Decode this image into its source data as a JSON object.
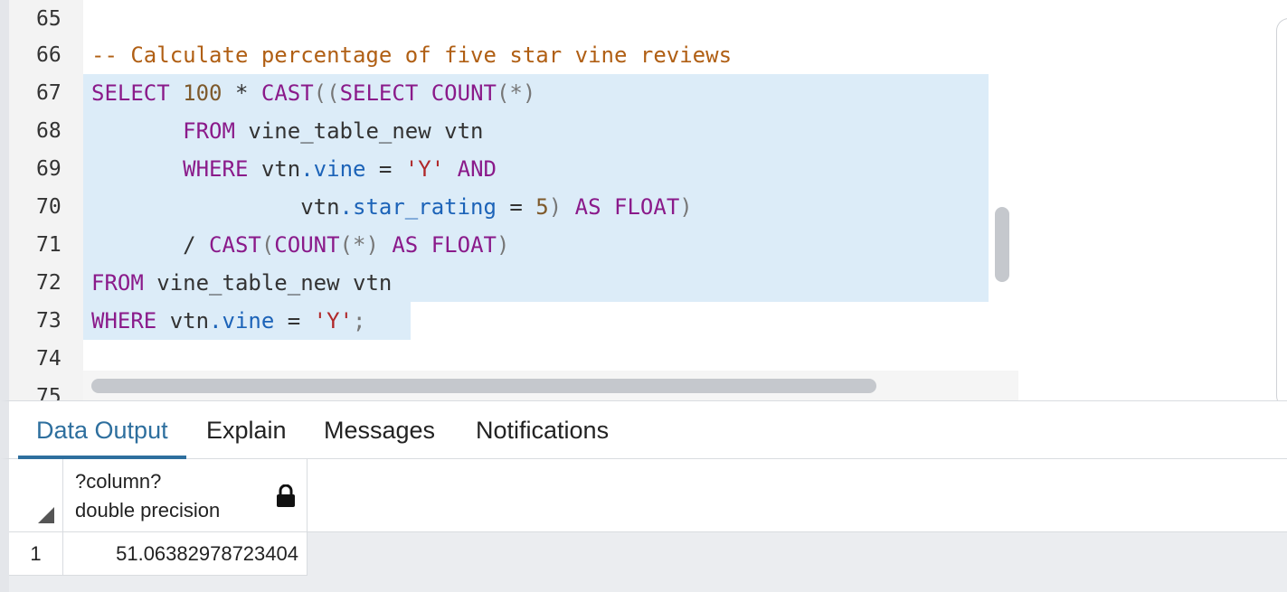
{
  "editor": {
    "line_numbers": [
      "65",
      "66",
      "67",
      "68",
      "69",
      "70",
      "71",
      "72",
      "73",
      "74",
      "75"
    ],
    "comment": "-- Calculate percentage of five star vine reviews",
    "kw": {
      "select": "SELECT",
      "from": "FROM",
      "where": "WHERE",
      "and": "AND",
      "as": "AS",
      "float": "FLOAT",
      "cast": "CAST",
      "count": "COUNT"
    },
    "num_100": "100",
    "num_5": "5",
    "table": "vine_table_new",
    "alias": "vtn",
    "prop_vine": ".vine",
    "prop_star": ".star_rating",
    "str_y": "'Y'"
  },
  "tabs": [
    {
      "label": "Data Output"
    },
    {
      "label": "Explain"
    },
    {
      "label": "Messages"
    },
    {
      "label": "Notifications"
    }
  ],
  "grid": {
    "column_name": "?column?",
    "column_type": "double precision",
    "rows": [
      {
        "num": "1",
        "value": "51.06382978723404"
      }
    ]
  },
  "icons": {
    "lock": "lock-icon",
    "corner": "select-all-triangle-icon"
  }
}
